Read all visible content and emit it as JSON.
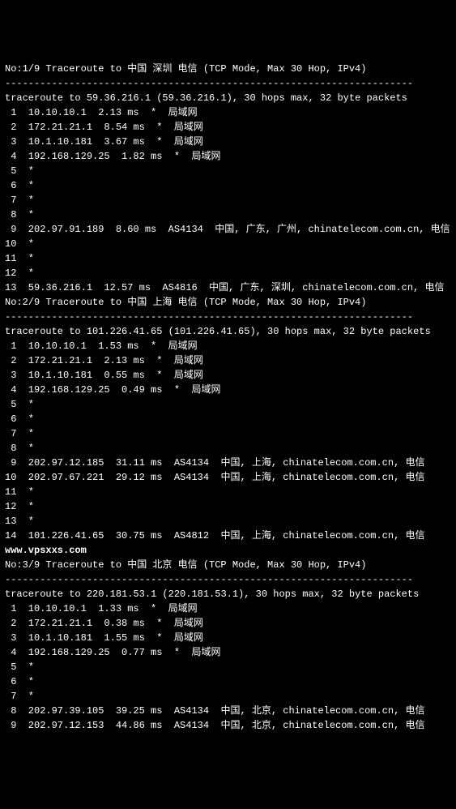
{
  "dashes": "----------------------------------------------------------------------",
  "watermark": "www.vpsxxs.com",
  "traces": [
    {
      "header": "No:1/9 Traceroute to 中国 深圳 电信 (TCP Mode, Max 30 Hop, IPv4)",
      "summary": "traceroute to 59.36.216.1 (59.36.216.1), 30 hops max, 32 byte packets",
      "hops": [
        " 1  10.10.10.1  2.13 ms  *  局域网",
        " 2  172.21.21.1  8.54 ms  *  局域网",
        " 3  10.1.10.181  3.67 ms  *  局域网",
        " 4  192.168.129.25  1.82 ms  *  局域网",
        " 5  *",
        " 6  *",
        " 7  *",
        " 8  *",
        " 9  202.97.91.189  8.60 ms  AS4134  中国, 广东, 广州, chinatelecom.com.cn, 电信",
        "10  *",
        "11  *",
        "12  *",
        "13  59.36.216.1  12.57 ms  AS4816  中国, 广东, 深圳, chinatelecom.com.cn, 电信"
      ]
    },
    {
      "header": "No:2/9 Traceroute to 中国 上海 电信 (TCP Mode, Max 30 Hop, IPv4)",
      "summary": "traceroute to 101.226.41.65 (101.226.41.65), 30 hops max, 32 byte packets",
      "hops": [
        " 1  10.10.10.1  1.53 ms  *  局域网",
        " 2  172.21.21.1  2.13 ms  *  局域网",
        " 3  10.1.10.181  0.55 ms  *  局域网",
        " 4  192.168.129.25  0.49 ms  *  局域网",
        " 5  *",
        " 6  *",
        " 7  *",
        " 8  *",
        " 9  202.97.12.185  31.11 ms  AS4134  中国, 上海, chinatelecom.com.cn, 电信",
        "10  202.97.67.221  29.12 ms  AS4134  中国, 上海, chinatelecom.com.cn, 电信",
        "11  *",
        "12  *",
        "13  *",
        "14  101.226.41.65  30.75 ms  AS4812  中国, 上海, chinatelecom.com.cn, 电信"
      ]
    },
    {
      "header": "No:3/9 Traceroute to 中国 北京 电信 (TCP Mode, Max 30 Hop, IPv4)",
      "summary": "traceroute to 220.181.53.1 (220.181.53.1), 30 hops max, 32 byte packets",
      "hops": [
        " 1  10.10.10.1  1.33 ms  *  局域网",
        " 2  172.21.21.1  0.38 ms  *  局域网",
        " 3  10.1.10.181  1.55 ms  *  局域网",
        " 4  192.168.129.25  0.77 ms  *  局域网",
        " 5  *",
        " 6  *",
        " 7  *",
        " 8  202.97.39.105  39.25 ms  AS4134  中国, 北京, chinatelecom.com.cn, 电信",
        " 9  202.97.12.153  44.86 ms  AS4134  中国, 北京, chinatelecom.com.cn, 电信"
      ]
    }
  ]
}
